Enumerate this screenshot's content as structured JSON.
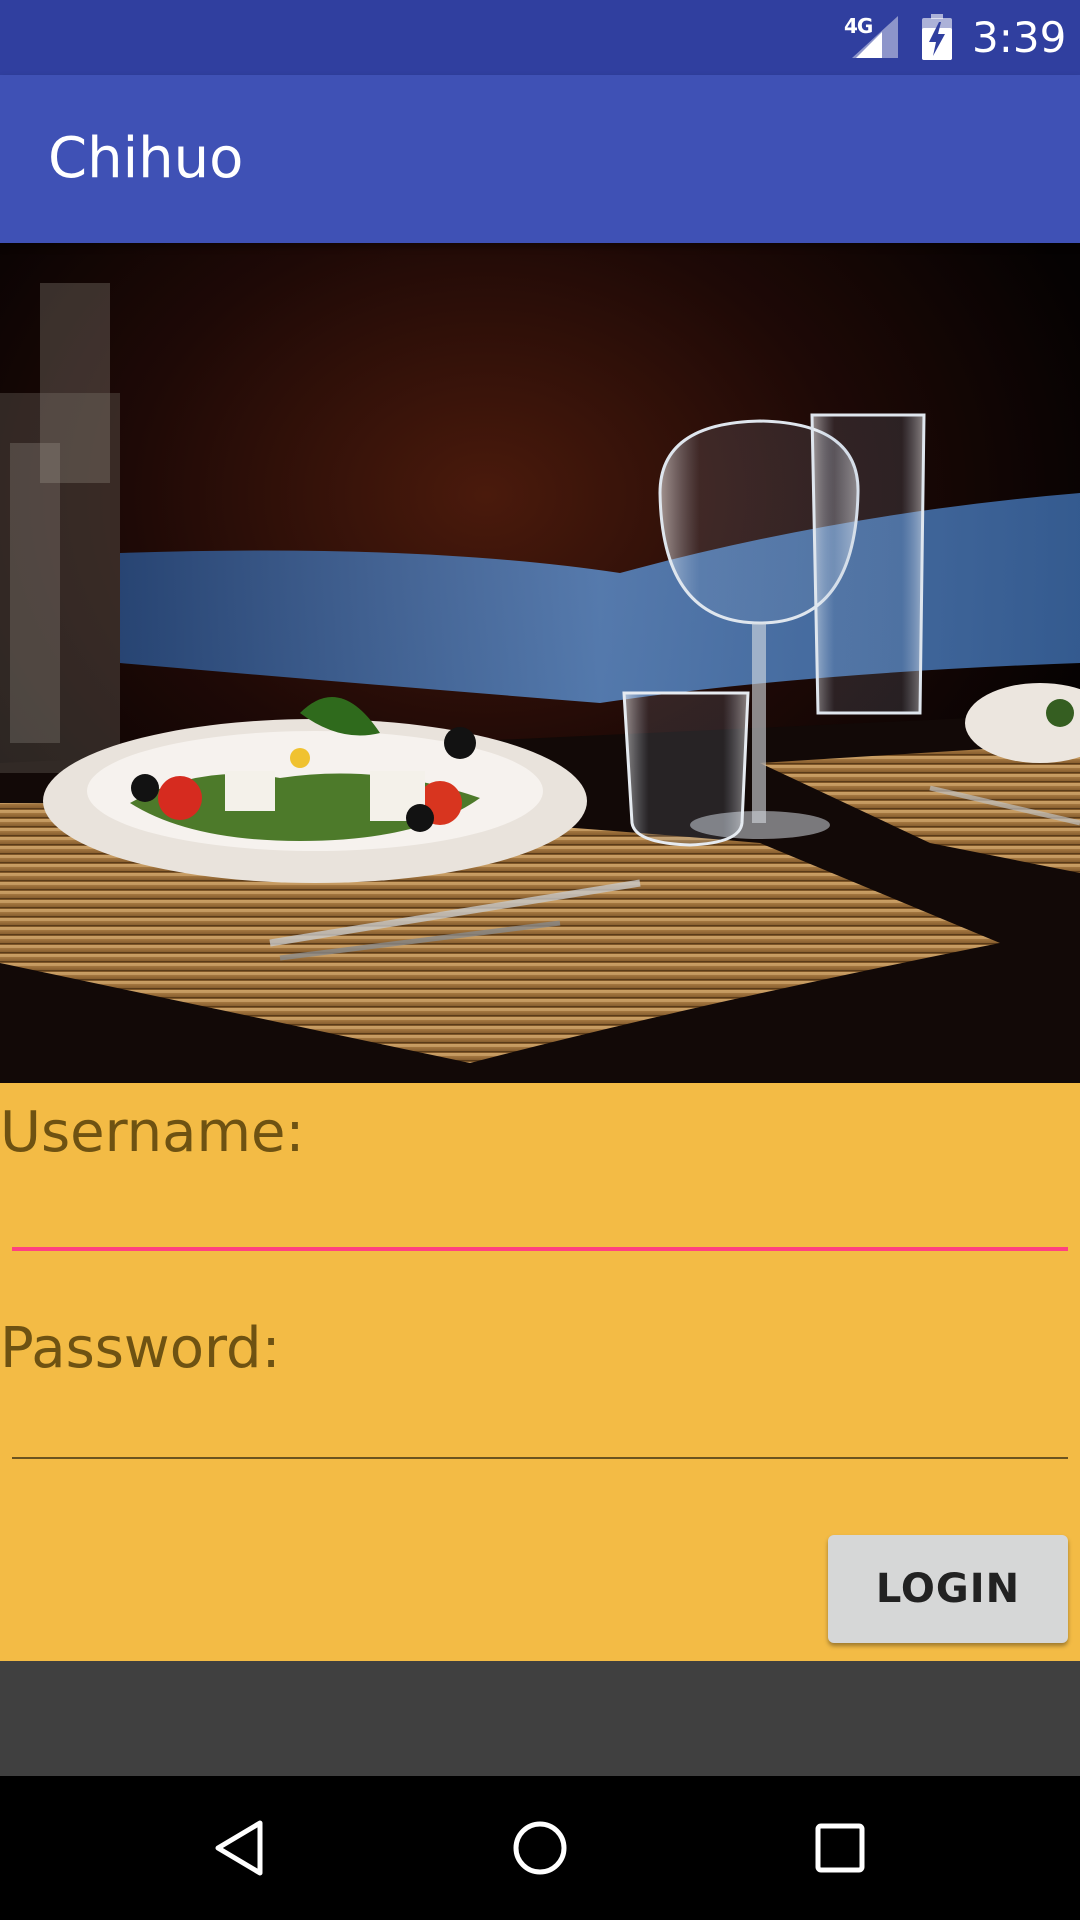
{
  "status_bar": {
    "network": "4G",
    "time": "3:39",
    "signal_icon": "cell-signal-icon",
    "battery_icon": "battery-charging-icon"
  },
  "app_bar": {
    "title": "Chihuo"
  },
  "hero": {
    "description_icon": "restaurant-table-photo"
  },
  "login": {
    "username_label": "Username:",
    "username_value": "",
    "password_label": "Password:",
    "password_value": "",
    "login_label": "LOGIN"
  },
  "nav_bar": {
    "back_icon": "back-triangle-icon",
    "home_icon": "home-circle-icon",
    "recents_icon": "recents-square-icon"
  },
  "colors": {
    "status_bar": "#303F9F",
    "app_bar": "#3F51B5",
    "panel": "#F3BB45",
    "accent": "#FF4081",
    "button": "#D6D7D7",
    "gray_area": "#404040"
  }
}
